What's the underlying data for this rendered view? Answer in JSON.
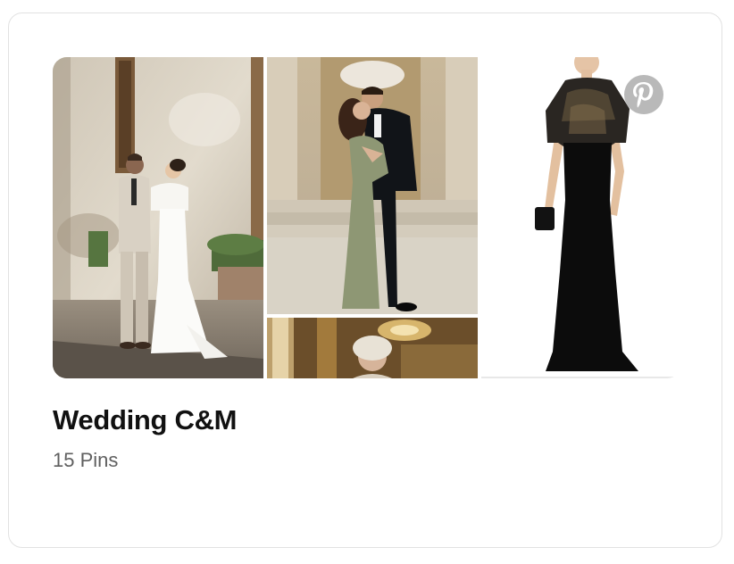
{
  "board": {
    "title": "Wedding C&M",
    "pin_count": "15 Pins"
  },
  "images": [
    {
      "description": "Couple in cream outfits against old stone wall",
      "icon": "photo-couple-stone-wall"
    },
    {
      "description": "Couple kissing in front of building with columns",
      "icon": "photo-couple-kissing"
    },
    {
      "description": "Older woman in ornate gold interior",
      "icon": "photo-woman-interior"
    },
    {
      "description": "Black lace-top evening gown",
      "icon": "photo-black-gown"
    }
  ],
  "badge": {
    "icon": "pinterest-logo-icon"
  },
  "colors": {
    "title": "#111111",
    "subtitle": "#5f5f5f",
    "border": "#e2e2e2",
    "badge": "#b9b9b9"
  }
}
